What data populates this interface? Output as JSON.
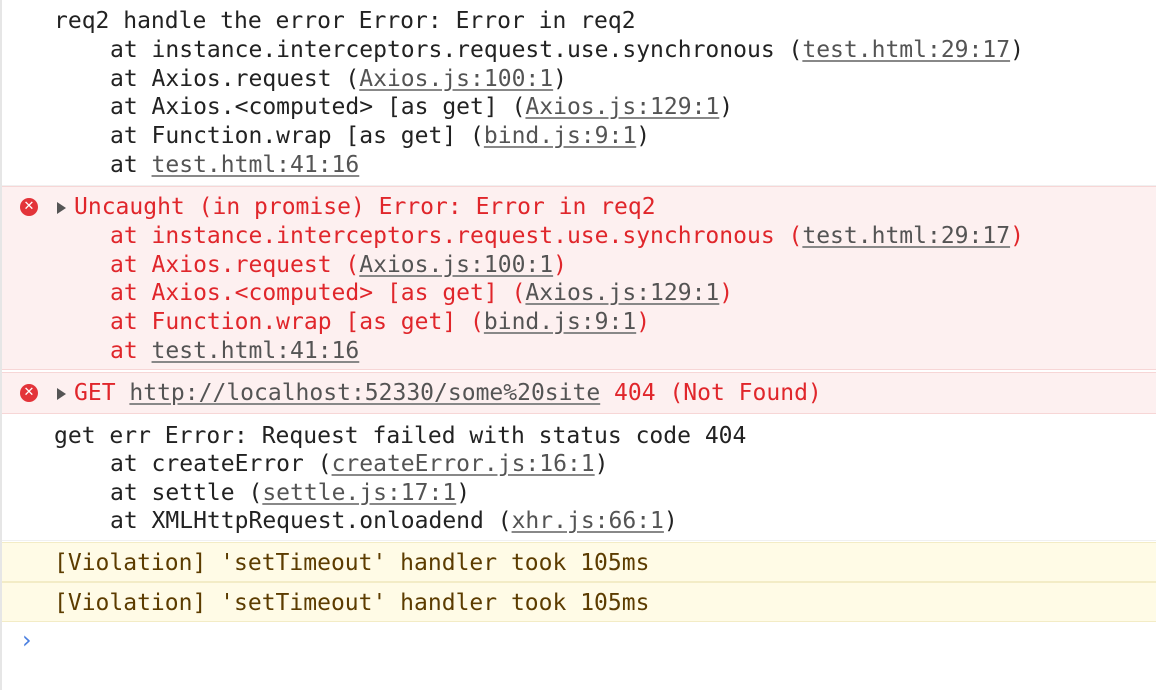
{
  "messages": {
    "req2_log": {
      "head": "req2 handle the error Error: Error in req2",
      "stack": [
        {
          "prefix": "at instance.interceptors.request.use.synchronous (",
          "link": "test.html:29:17",
          "suffix": ")"
        },
        {
          "prefix": "at Axios.request (",
          "link": "Axios.js:100:1",
          "suffix": ")"
        },
        {
          "prefix": "at Axios.<computed> [as get] (",
          "link": "Axios.js:129:1",
          "suffix": ")"
        },
        {
          "prefix": "at Function.wrap [as get] (",
          "link": "bind.js:9:1",
          "suffix": ")"
        },
        {
          "prefix": "at ",
          "link": "test.html:41:16",
          "suffix": ""
        }
      ]
    },
    "uncaught_error": {
      "icon": "✕",
      "head": "Uncaught (in promise) Error: Error in req2",
      "stack": [
        {
          "prefix": "at instance.interceptors.request.use.synchronous (",
          "link": "test.html:29:17",
          "suffix": ")"
        },
        {
          "prefix": "at Axios.request (",
          "link": "Axios.js:100:1",
          "suffix": ")"
        },
        {
          "prefix": "at Axios.<computed> [as get] (",
          "link": "Axios.js:129:1",
          "suffix": ")"
        },
        {
          "prefix": "at Function.wrap [as get] (",
          "link": "bind.js:9:1",
          "suffix": ")"
        },
        {
          "prefix": "at ",
          "link": "test.html:41:16",
          "suffix": ""
        }
      ]
    },
    "get_error": {
      "icon": "✕",
      "method": "GET ",
      "url": "http://localhost:52330/some%20site",
      "status": " 404 (Not Found)"
    },
    "get_err_log": {
      "head": "get err Error: Request failed with status code 404",
      "stack": [
        {
          "prefix": "at createError (",
          "link": "createError.js:16:1",
          "suffix": ")"
        },
        {
          "prefix": "at settle (",
          "link": "settle.js:17:1",
          "suffix": ")"
        },
        {
          "prefix": "at XMLHttpRequest.onloadend (",
          "link": "xhr.js:66:1",
          "suffix": ")"
        }
      ]
    },
    "violation_1": "[Violation] 'setTimeout' handler took 105ms",
    "violation_2": "[Violation] 'setTimeout' handler took 105ms"
  },
  "prompt": {
    "symbol": "›"
  },
  "colors": {
    "error_text": "#e0262b",
    "error_bg": "#fdf0f0",
    "warning_bg": "#fffbe6",
    "warning_text": "#5c3c00",
    "prompt": "#4a7fe0"
  }
}
